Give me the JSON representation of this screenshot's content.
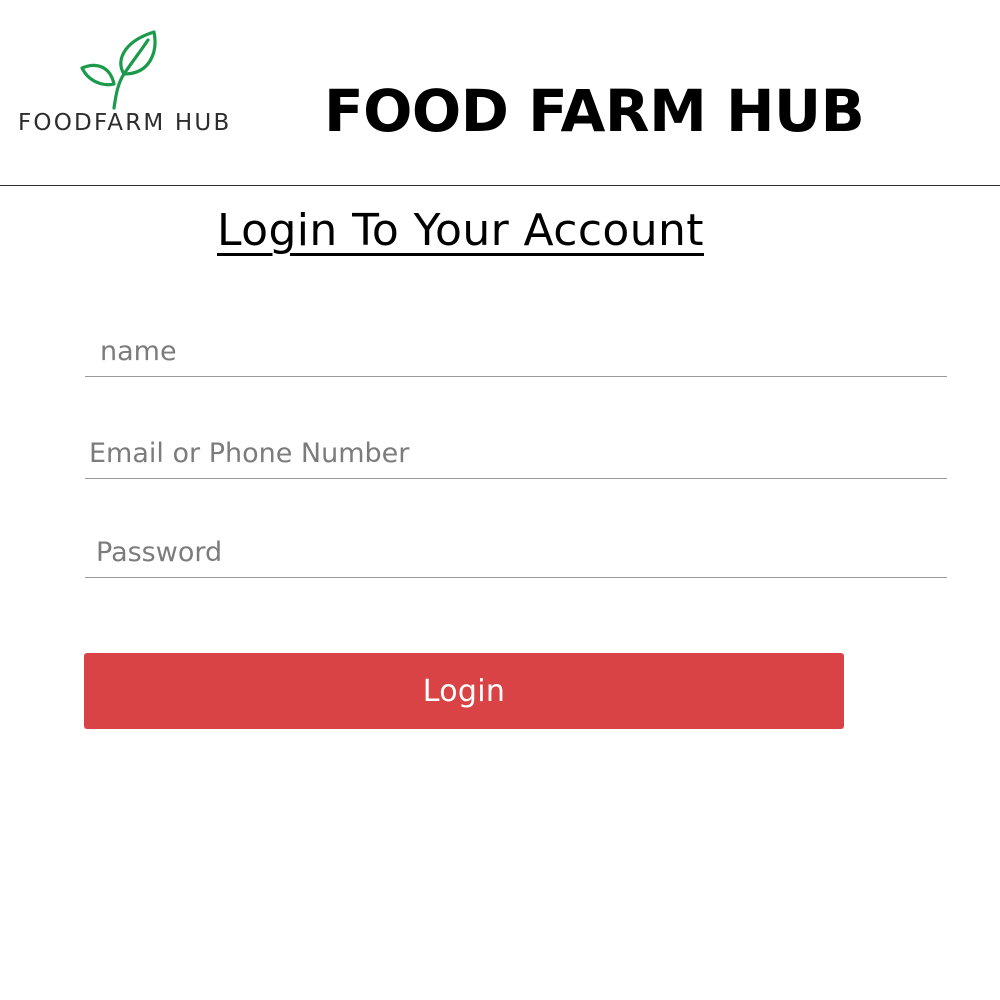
{
  "header": {
    "logo_text": "FOODFARM HUB",
    "logo_icon": "leaf-sprout-icon",
    "title": "FOOD FARM HUB"
  },
  "login_form": {
    "heading": "Login To Your Account",
    "fields": {
      "name": {
        "placeholder": "name",
        "value": ""
      },
      "email": {
        "placeholder": "Email or Phone Number",
        "value": ""
      },
      "password": {
        "placeholder": "Password",
        "value": ""
      }
    },
    "submit_label": "Login"
  },
  "colors": {
    "logo_green": "#1a9a4a",
    "button_red": "#d94345",
    "button_text": "#ffffff"
  }
}
